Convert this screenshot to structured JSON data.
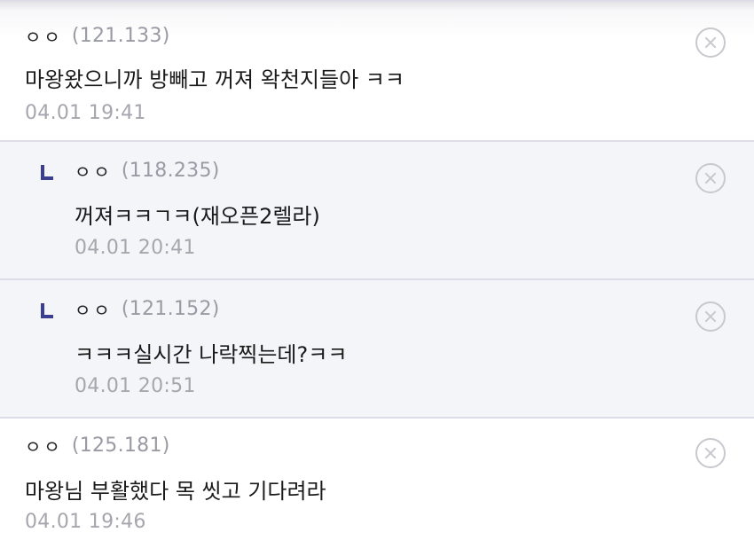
{
  "comments": [
    {
      "nick": "ㅇㅇ",
      "ip": "(121.133)",
      "text": "마왕왔으니까 방빼고 꺼져 왁천지들아 ㅋㅋ",
      "date": "04.01 19:41",
      "is_reply": false
    },
    {
      "nick": "ㅇㅇ",
      "ip": "(118.235)",
      "text": "꺼져ㅋㅋㄱㅋ(재오픈2렐라)",
      "date": "04.01 20:41",
      "is_reply": true
    },
    {
      "nick": "ㅇㅇ",
      "ip": "(121.152)",
      "text": "ㅋㅋㅋ실시간 나락찍는데?ㅋㅋ",
      "date": "04.01 20:51",
      "is_reply": true
    },
    {
      "nick": "ㅇㅇ",
      "ip": "(125.181)",
      "text": "마왕님 부활했다 목 씻고 기다려라",
      "date": "04.01 19:46",
      "is_reply": false
    }
  ],
  "icons": {
    "delete": "close-circle-icon",
    "reply_marker": "reply-arrow-icon"
  },
  "colors": {
    "reply_background": "#f4f5f9",
    "reply_marker": "#3b3f8f",
    "meta_gray": "#9a9aa4"
  }
}
